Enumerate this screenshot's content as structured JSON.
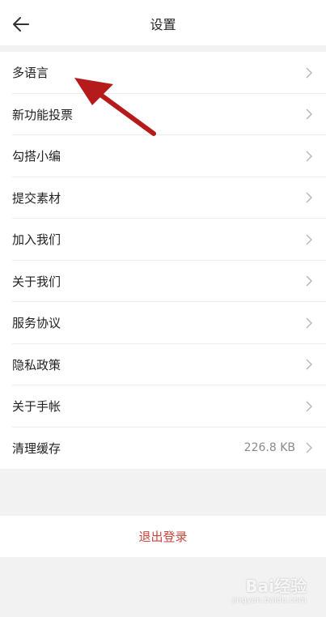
{
  "header": {
    "title": "设置",
    "back_icon": "arrow-left-icon"
  },
  "settings": {
    "items": [
      {
        "label": "多语言",
        "value": ""
      },
      {
        "label": "新功能投票",
        "value": ""
      },
      {
        "label": "勾搭小编",
        "value": ""
      },
      {
        "label": "提交素材",
        "value": ""
      },
      {
        "label": "加入我们",
        "value": ""
      },
      {
        "label": "关于我们",
        "value": ""
      },
      {
        "label": "服务协议",
        "value": ""
      },
      {
        "label": "隐私政策",
        "value": ""
      },
      {
        "label": "关于手帐",
        "value": ""
      },
      {
        "label": "清理缓存",
        "value": "226.8 KB"
      }
    ]
  },
  "logout": {
    "label": "退出登录",
    "color": "#c9463d"
  },
  "annotation": {
    "arrow_color": "#b61b1b"
  },
  "watermark": {
    "text": "Bai经验",
    "sub": "jingyan.baidu.com"
  }
}
